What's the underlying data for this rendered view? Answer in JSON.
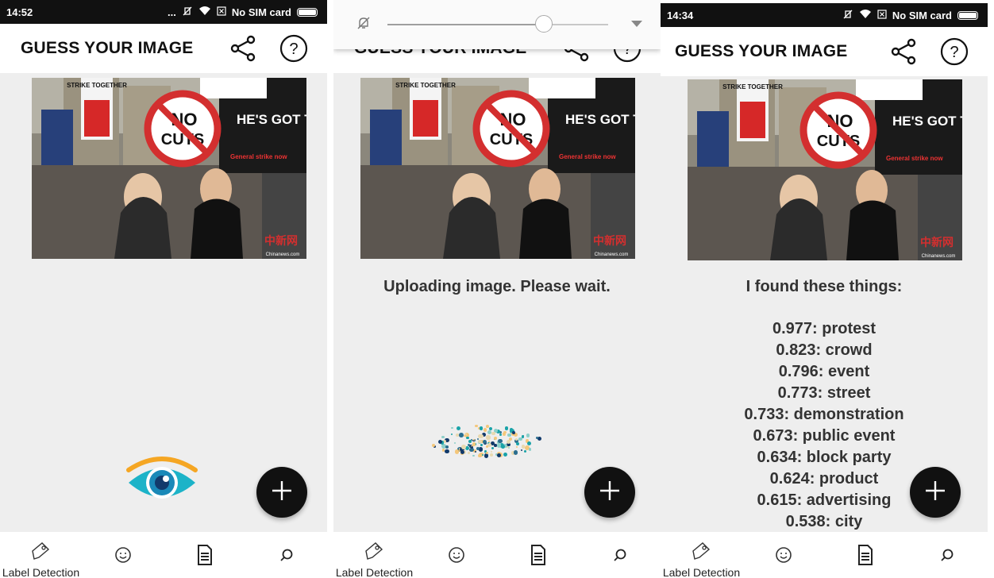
{
  "app": {
    "title": "GUESS YOUR IMAGE"
  },
  "screens": [
    {
      "status": {
        "time": "14:52",
        "left_extra": "...",
        "sim": "No SIM card"
      }
    },
    {
      "volume": {
        "level_fraction": 0.71
      },
      "message": "Uploading image. Please wait."
    },
    {
      "status": {
        "time": "14:34",
        "sim": "No SIM card"
      },
      "heading": "I found these things:",
      "labels": [
        "0.977: protest",
        "0.823: crowd",
        "0.796: event",
        "0.773: street",
        "0.733: demonstration",
        "0.673: public event",
        "0.634: block party",
        "0.624: product",
        "0.615: advertising",
        "0.538: city"
      ]
    }
  ],
  "photo": {
    "signs": [
      "STRIKE TOGETHER",
      "NO",
      "CUTS",
      "HE'S GOT TO GO",
      "General strike now"
    ],
    "watermark": "中新网",
    "watermark_sub": "Chinanews.com"
  },
  "bottom_nav": {
    "items": [
      {
        "label": "Label Detection",
        "icon": "tag-icon"
      },
      {
        "label": "",
        "icon": "face-icon"
      },
      {
        "label": "",
        "icon": "document-icon"
      },
      {
        "label": "",
        "icon": "search-icon"
      }
    ]
  },
  "icons": {
    "share": "share-icon",
    "help": "help-icon",
    "fab": "add-icon",
    "eye": "eye-icon"
  },
  "colors": {
    "eye_teal": "#1cb3c8",
    "eye_orange": "#f5a623",
    "eye_navy": "#123a6b",
    "fab": "#111111"
  }
}
